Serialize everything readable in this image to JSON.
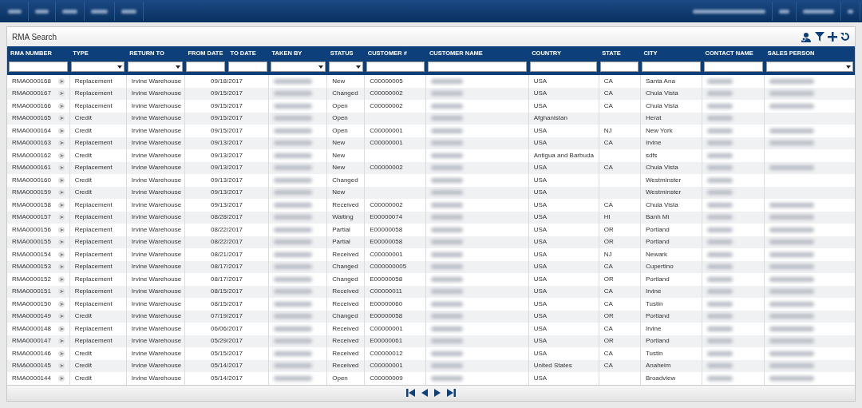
{
  "panel": {
    "title": "RMA Search"
  },
  "columns": [
    {
      "label": "RMA NUMBER",
      "kind": "input"
    },
    {
      "label": "TYPE",
      "kind": "select"
    },
    {
      "label": "RETURN TO",
      "kind": "select"
    },
    {
      "label": "FROM DATE",
      "kind": "input"
    },
    {
      "label": "TO DATE",
      "kind": "input"
    },
    {
      "label": "TAKEN BY",
      "kind": "select"
    },
    {
      "label": "STATUS",
      "kind": "select"
    },
    {
      "label": "CUSTOMER #",
      "kind": "input"
    },
    {
      "label": "CUSTOMER NAME",
      "kind": "input"
    },
    {
      "label": "COUNTRY",
      "kind": "input"
    },
    {
      "label": "STATE",
      "kind": "input"
    },
    {
      "label": "CITY",
      "kind": "input"
    },
    {
      "label": "CONTACT NAME",
      "kind": "input"
    },
    {
      "label": "SALES PERSON",
      "kind": "select"
    }
  ],
  "rows": [
    {
      "rma": "RMA0000168",
      "type": "Replacement",
      "return_to": "Irvine Warehouse",
      "date": "09/18/2017",
      "status": "New",
      "customer_no": "C00000005",
      "country": "USA",
      "state": "CA",
      "city": "Santa Ana",
      "sales_person_blurred": true
    },
    {
      "rma": "RMA0000167",
      "type": "Replacement",
      "return_to": "Irvine Warehouse",
      "date": "09/15/2017",
      "status": "Changed",
      "customer_no": "C00000002",
      "country": "USA",
      "state": "CA",
      "city": "Chula Vista",
      "sales_person_blurred": true
    },
    {
      "rma": "RMA0000166",
      "type": "Replacement",
      "return_to": "Irvine Warehouse",
      "date": "09/15/2017",
      "status": "Open",
      "customer_no": "C00000002",
      "country": "USA",
      "state": "CA",
      "city": "Chula Vista",
      "sales_person_blurred": true
    },
    {
      "rma": "RMA0000165",
      "type": "Credit",
      "return_to": "Irvine Warehouse",
      "date": "09/15/2017",
      "status": "Open",
      "country": "Afghanistan",
      "city": "Herat",
      "sales_person_blurred": false
    },
    {
      "rma": "RMA0000164",
      "type": "Credit",
      "return_to": "Irvine Warehouse",
      "date": "09/15/2017",
      "status": "Open",
      "customer_no": "C00000001",
      "country": "USA",
      "state": "NJ",
      "city": "New York",
      "sales_person_blurred": true
    },
    {
      "rma": "RMA0000163",
      "type": "Replacement",
      "return_to": "Irvine Warehouse",
      "date": "09/13/2017",
      "status": "New",
      "customer_no": "C00000001",
      "country": "USA",
      "state": "CA",
      "city": "Irvine",
      "sales_person_blurred": true
    },
    {
      "rma": "RMA0000162",
      "type": "Credit",
      "return_to": "Irvine Warehouse",
      "date": "09/13/2017",
      "status": "New",
      "country": "Antigua and Barbuda",
      "city": "sdfs",
      "sales_person_blurred": false
    },
    {
      "rma": "RMA0000161",
      "type": "Replacement",
      "return_to": "Irvine Warehouse",
      "date": "09/13/2017",
      "status": "New",
      "customer_no": "C00000002",
      "country": "USA",
      "state": "CA",
      "city": "Chula Vista",
      "sales_person_blurred": true
    },
    {
      "rma": "RMA0000160",
      "type": "Credit",
      "return_to": "Irvine Warehouse",
      "date": "09/13/2017",
      "status": "Changed",
      "country": "USA",
      "city": "Westminster",
      "sales_person_blurred": false
    },
    {
      "rma": "RMA0000159",
      "type": "Credit",
      "return_to": "Irvine Warehouse",
      "date": "09/13/2017",
      "status": "New",
      "country": "USA",
      "city": "Westminster",
      "sales_person_blurred": false
    },
    {
      "rma": "RMA0000158",
      "type": "Replacement",
      "return_to": "Irvine Warehouse",
      "date": "09/13/2017",
      "status": "Received",
      "customer_no": "C00000002",
      "country": "USA",
      "state": "CA",
      "city": "Chula Vista",
      "sales_person_blurred": true
    },
    {
      "rma": "RMA0000157",
      "type": "Replacement",
      "return_to": "Irvine Warehouse",
      "date": "08/28/2017",
      "status": "Waiting",
      "customer_no": "E00000074",
      "country": "USA",
      "state": "HI",
      "city": "Banh Mi",
      "sales_person_blurred": true
    },
    {
      "rma": "RMA0000156",
      "type": "Replacement",
      "return_to": "Irvine Warehouse",
      "date": "08/22/2017",
      "status": "Partial",
      "customer_no": "E00000058",
      "country": "USA",
      "state": "OR",
      "city": "Portland",
      "sales_person_blurred": true
    },
    {
      "rma": "RMA0000155",
      "type": "Replacement",
      "return_to": "Irvine Warehouse",
      "date": "08/22/2017",
      "status": "Partial",
      "customer_no": "E00000058",
      "country": "USA",
      "state": "OR",
      "city": "Portland",
      "sales_person_blurred": true
    },
    {
      "rma": "RMA0000154",
      "type": "Replacement",
      "return_to": "Irvine Warehouse",
      "date": "08/21/2017",
      "status": "Received",
      "customer_no": "C00000001",
      "country": "USA",
      "state": "NJ",
      "city": "Newark",
      "sales_person_blurred": true
    },
    {
      "rma": "RMA0000153",
      "type": "Replacement",
      "return_to": "Irvine Warehouse",
      "date": "08/17/2017",
      "status": "Changed",
      "customer_no": "C000000005",
      "country": "USA",
      "state": "CA",
      "city": "Cupertino",
      "sales_person_blurred": true
    },
    {
      "rma": "RMA0000152",
      "type": "Replacement",
      "return_to": "Irvine Warehouse",
      "date": "08/17/2017",
      "status": "Changed",
      "customer_no": "E00000058",
      "country": "USA",
      "state": "OR",
      "city": "Portland",
      "sales_person_blurred": true
    },
    {
      "rma": "RMA0000151",
      "type": "Replacement",
      "return_to": "Irvine Warehouse",
      "date": "08/15/2017",
      "status": "Received",
      "customer_no": "C00000011",
      "country": "USA",
      "state": "CA",
      "city": "Irvine",
      "sales_person_blurred": true
    },
    {
      "rma": "RMA0000150",
      "type": "Replacement",
      "return_to": "Irvine Warehouse",
      "date": "08/15/2017",
      "status": "Received",
      "customer_no": "E00000060",
      "country": "USA",
      "state": "CA",
      "city": "Tustin",
      "sales_person_blurred": true
    },
    {
      "rma": "RMA0000149",
      "type": "Credit",
      "return_to": "Irvine Warehouse",
      "date": "07/19/2017",
      "status": "Changed",
      "customer_no": "E00000058",
      "country": "USA",
      "state": "OR",
      "city": "Portland",
      "sales_person_blurred": true
    },
    {
      "rma": "RMA0000148",
      "type": "Replacement",
      "return_to": "Irvine Warehouse",
      "date": "06/06/2017",
      "status": "Received",
      "customer_no": "C00000001",
      "country": "USA",
      "state": "CA",
      "city": "Irvine",
      "sales_person_blurred": true
    },
    {
      "rma": "RMA0000147",
      "type": "Replacement",
      "return_to": "Irvine Warehouse",
      "date": "05/29/2017",
      "status": "Received",
      "customer_no": "E00000061",
      "country": "USA",
      "state": "OR",
      "city": "Portland",
      "sales_person_blurred": true
    },
    {
      "rma": "RMA0000146",
      "type": "Credit",
      "return_to": "Irvine Warehouse",
      "date": "05/15/2017",
      "status": "Received",
      "customer_no": "C00000012",
      "country": "USA",
      "state": "CA",
      "city": "Tustin",
      "sales_person_blurred": true
    },
    {
      "rma": "RMA0000145",
      "type": "Credit",
      "return_to": "Irvine Warehouse",
      "date": "05/14/2017",
      "status": "Received",
      "customer_no": "C00000001",
      "country": "United States",
      "state": "CA",
      "city": "Anaheim",
      "sales_person_blurred": true
    },
    {
      "rma": "RMA0000144",
      "type": "Credit",
      "return_to": "Irvine Warehouse",
      "date": "05/14/2017",
      "status": "Open",
      "customer_no": "C00000009",
      "country": "USA",
      "city": "Broadview",
      "sales_person_blurred": true
    }
  ]
}
